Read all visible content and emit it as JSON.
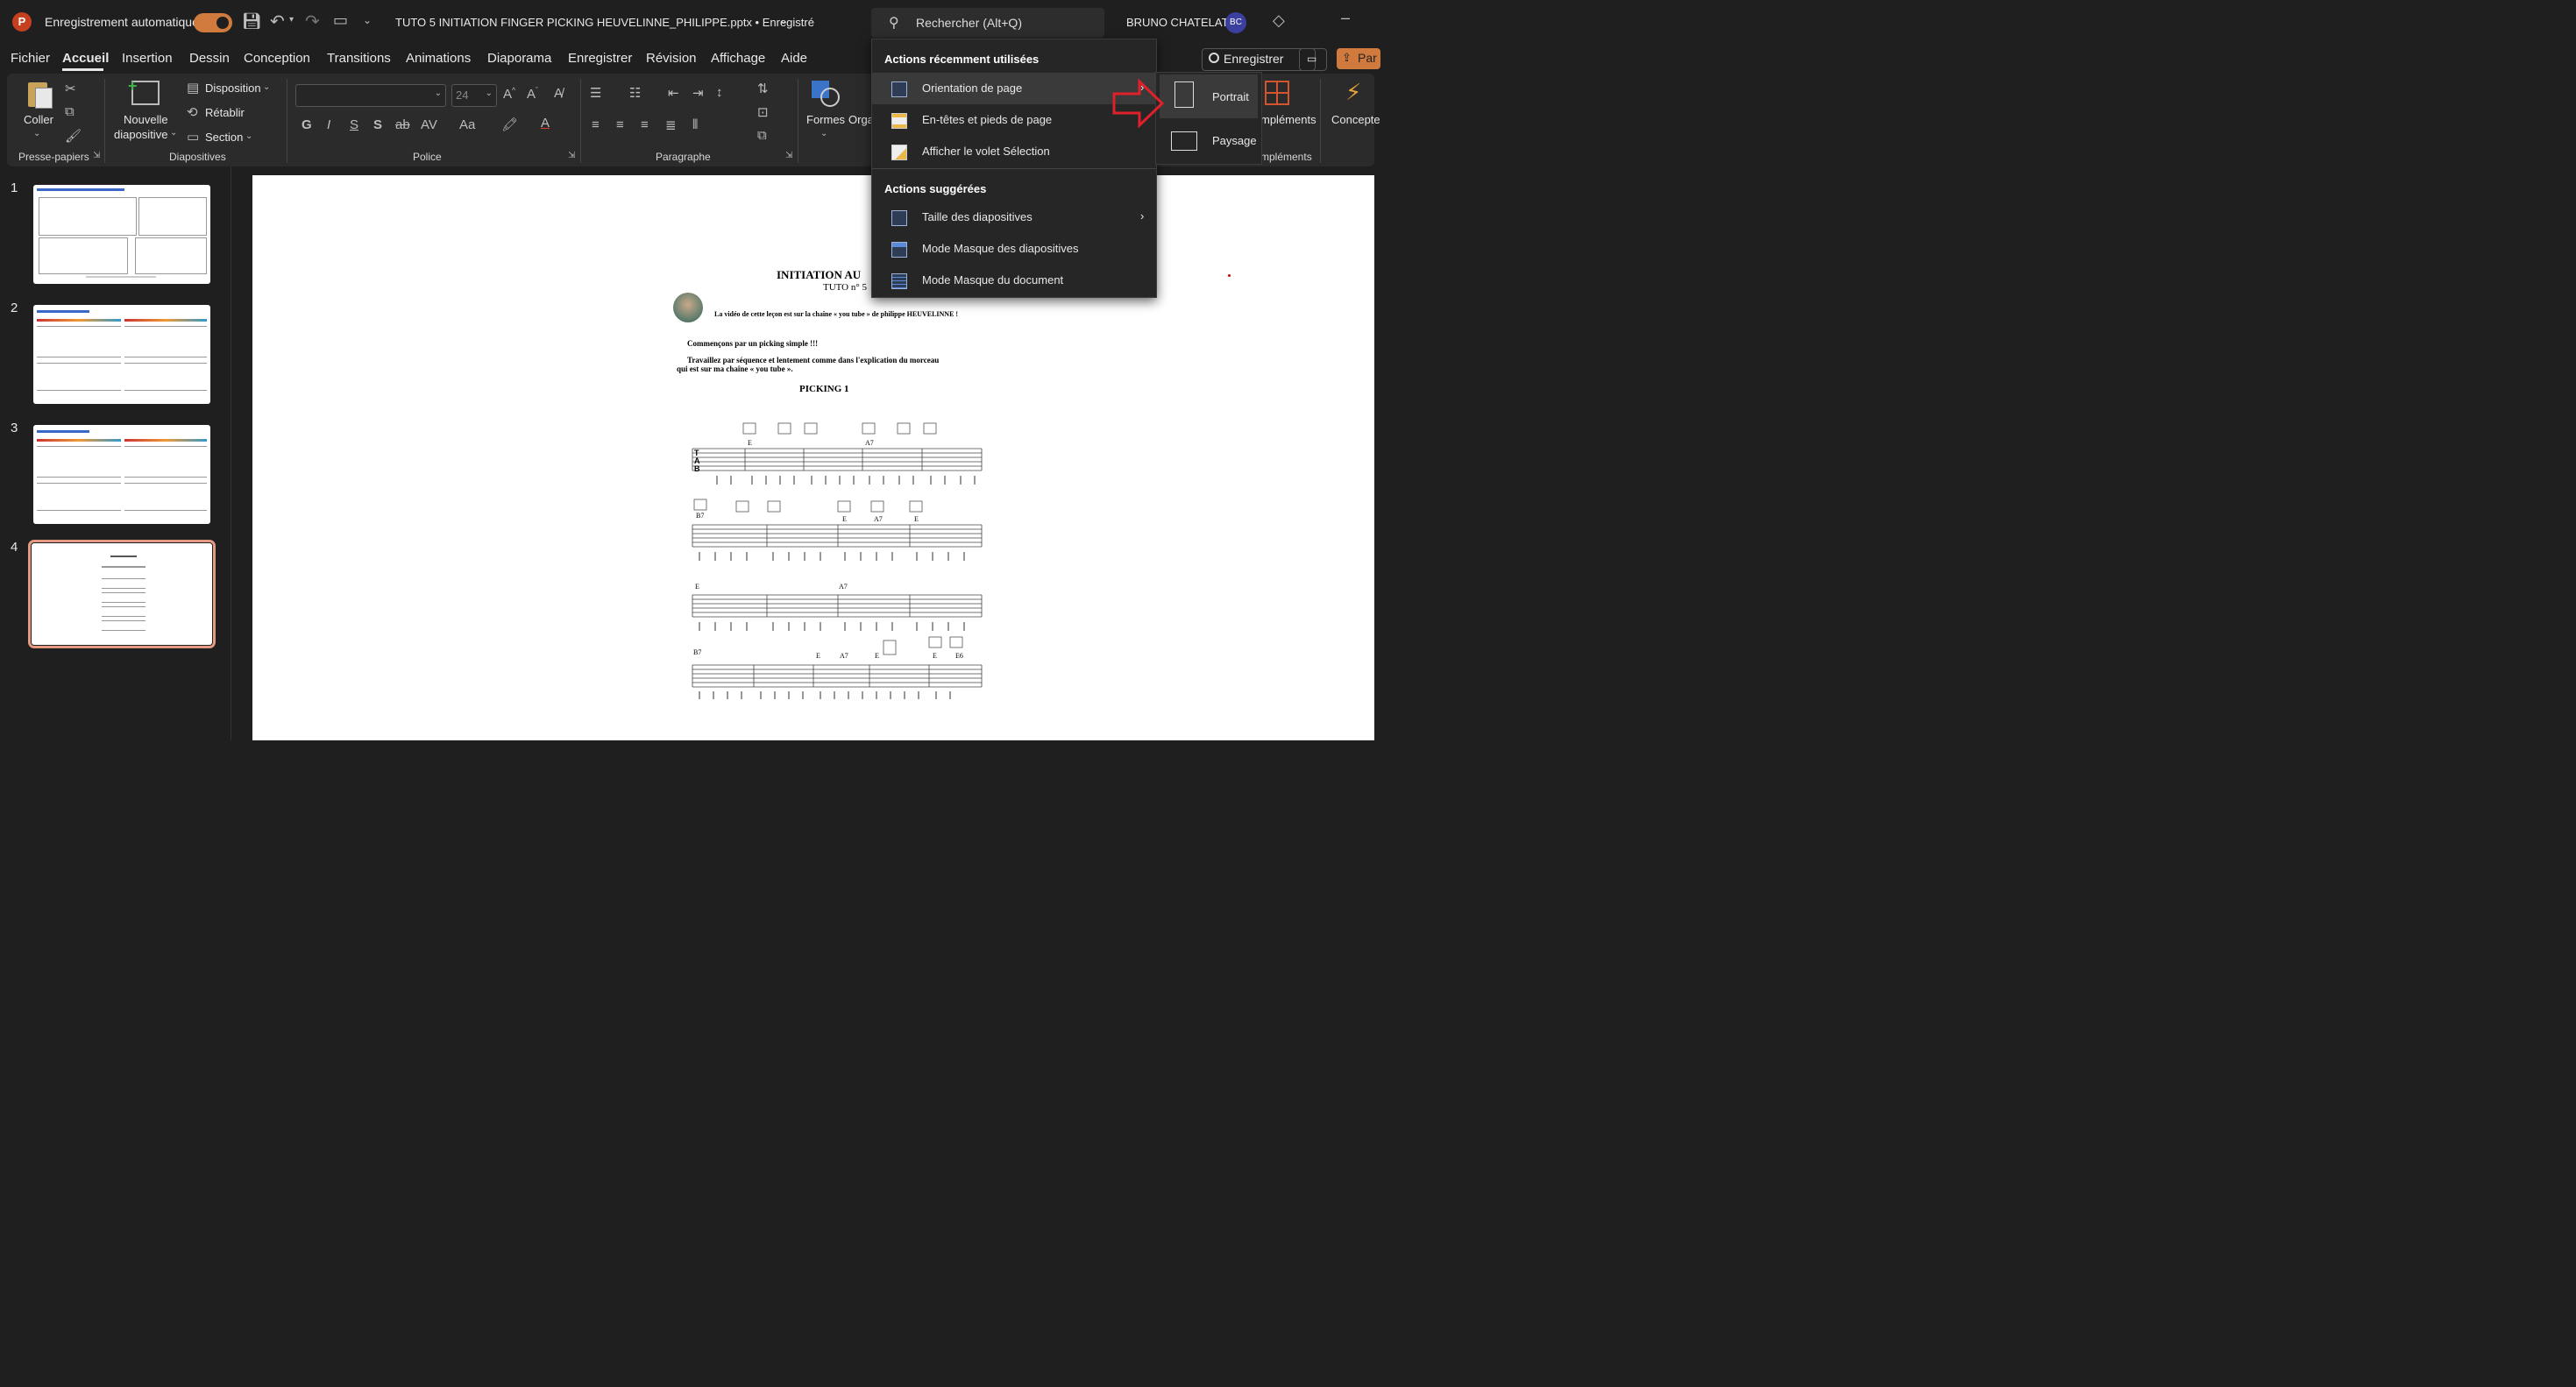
{
  "titlebar": {
    "autosave_label": "Enregistrement automatique",
    "doc_title": "TUTO 5 INITIATION FINGER PICKING HEUVELINNE_PHILIPPE.pptx • Enregistré",
    "search_placeholder": "Rechercher (Alt+Q)",
    "user_name": "BRUNO CHATELAT",
    "user_initials": "BC"
  },
  "menu": {
    "tabs": [
      "Fichier",
      "Accueil",
      "Insertion",
      "Dessin",
      "Conception",
      "Transitions",
      "Animations",
      "Diaporama",
      "Enregistrer",
      "Révision",
      "Affichage",
      "Aide"
    ],
    "record_button": "Enregistrer",
    "share_button": "Par"
  },
  "ribbon": {
    "paste_label": "Coller",
    "clipboard_group": "Presse-papiers",
    "new_slide_label_1": "Nouvelle",
    "new_slide_label_2": "diapositive",
    "layout_label": "Disposition",
    "reset_label": "Rétablir",
    "section_label": "Section",
    "slides_group": "Diapositives",
    "font_size": "24",
    "font_group": "Police",
    "paragraph_group": "Paragraphe",
    "shapes_label": "Formes",
    "arrange_partial": "Orga",
    "addins_partial": "mpléments",
    "addins_group_partial": "mpléments",
    "designer_partial": "Concepte"
  },
  "thumbnails": {
    "numbers": [
      "1",
      "2",
      "3",
      "4"
    ],
    "selected_index": 4
  },
  "dropdown": {
    "recent_header": "Actions récemment utilisées",
    "recent_items": [
      "Orientation de page",
      "En-têtes et pieds de page",
      "Afficher le volet Sélection"
    ],
    "suggested_header": "Actions suggérées",
    "suggested_items": [
      "Taille des diapositives",
      "Mode Masque des diapositives",
      "Mode Masque du document"
    ]
  },
  "submenu": {
    "portrait": "Portrait",
    "landscape": "Paysage"
  },
  "slide": {
    "title": "INITIATION AU",
    "subtitle": "TUTO n° 5",
    "video_note": "La vidéo de cette leçon est sur la chaîne « you tube » de philippe HEUVELINNE  !",
    "intro": "Commençons par un picking simple  !!!",
    "instruction_1": "Travaillez par séquence et lentement comme dans l'explication du morceau",
    "instruction_2": "qui est sur ma chaîne « you tube ».",
    "section_title": "PICKING 1",
    "tab_letters": [
      "T",
      "A",
      "B"
    ],
    "chords_row1": [
      "E",
      "A7"
    ],
    "chords_row2": [
      "B7",
      "E",
      "A7",
      "E"
    ],
    "chords_row3": [
      "E",
      "A7"
    ],
    "chords_row4": [
      "B7",
      "E",
      "A7",
      "E",
      "E",
      "E6"
    ]
  },
  "colors": {
    "accent": "#d17a3e",
    "selection_outline": "#e59a82",
    "arrow_red": "#e0202a",
    "avatar": "#3b3fa0"
  }
}
